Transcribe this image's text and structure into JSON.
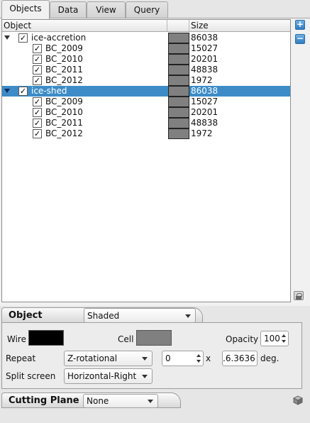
{
  "tabs": [
    {
      "label": "Objects",
      "active": true
    },
    {
      "label": "Data",
      "active": false
    },
    {
      "label": "View",
      "active": false
    },
    {
      "label": "Query",
      "active": false
    }
  ],
  "tree": {
    "columns": {
      "object": "Object",
      "color": "",
      "size": "Size"
    },
    "groups": [
      {
        "label": "ice-accretion",
        "checked": true,
        "expanded": true,
        "selected": false,
        "color": "#808080",
        "size": "86038",
        "children": [
          {
            "label": "BC_2009",
            "checked": true,
            "color": "#808080",
            "size": "15027"
          },
          {
            "label": "BC_2010",
            "checked": true,
            "color": "#808080",
            "size": "20201"
          },
          {
            "label": "BC_2011",
            "checked": true,
            "color": "#808080",
            "size": "48838"
          },
          {
            "label": "BC_2012",
            "checked": true,
            "color": "#808080",
            "size": "1972"
          }
        ]
      },
      {
        "label": "ice-shed",
        "checked": true,
        "expanded": true,
        "selected": true,
        "color": "#808080",
        "size": "86038",
        "children": [
          {
            "label": "BC_2009",
            "checked": true,
            "color": "#808080",
            "size": "15027"
          },
          {
            "label": "BC_2010",
            "checked": true,
            "color": "#808080",
            "size": "20201"
          },
          {
            "label": "BC_2011",
            "checked": true,
            "color": "#808080",
            "size": "48838"
          },
          {
            "label": "BC_2012",
            "checked": true,
            "color": "#808080",
            "size": "1972"
          }
        ]
      }
    ],
    "side_buttons": {
      "add": "+",
      "remove": "−"
    }
  },
  "object_section": {
    "title": "Object",
    "render_mode": "Shaded",
    "wire_label": "Wire",
    "wire_color": "#000000",
    "cell_label": "Cell",
    "cell_color": "#808080",
    "opacity_label": "Opacity",
    "opacity_value": "100",
    "repeat_label": "Repeat",
    "repeat_value": "Z-rotational",
    "repeat_count": "0",
    "times_label": "x",
    "angle_value": ".6.3636",
    "angle_unit": "deg.",
    "split_label": "Split screen",
    "split_value": "Horizontal-Right"
  },
  "cutting_plane": {
    "title": "Cutting Plane",
    "value": "None"
  },
  "selection_color": "#3d8cc8",
  "accent_color": "#2f7cc1"
}
